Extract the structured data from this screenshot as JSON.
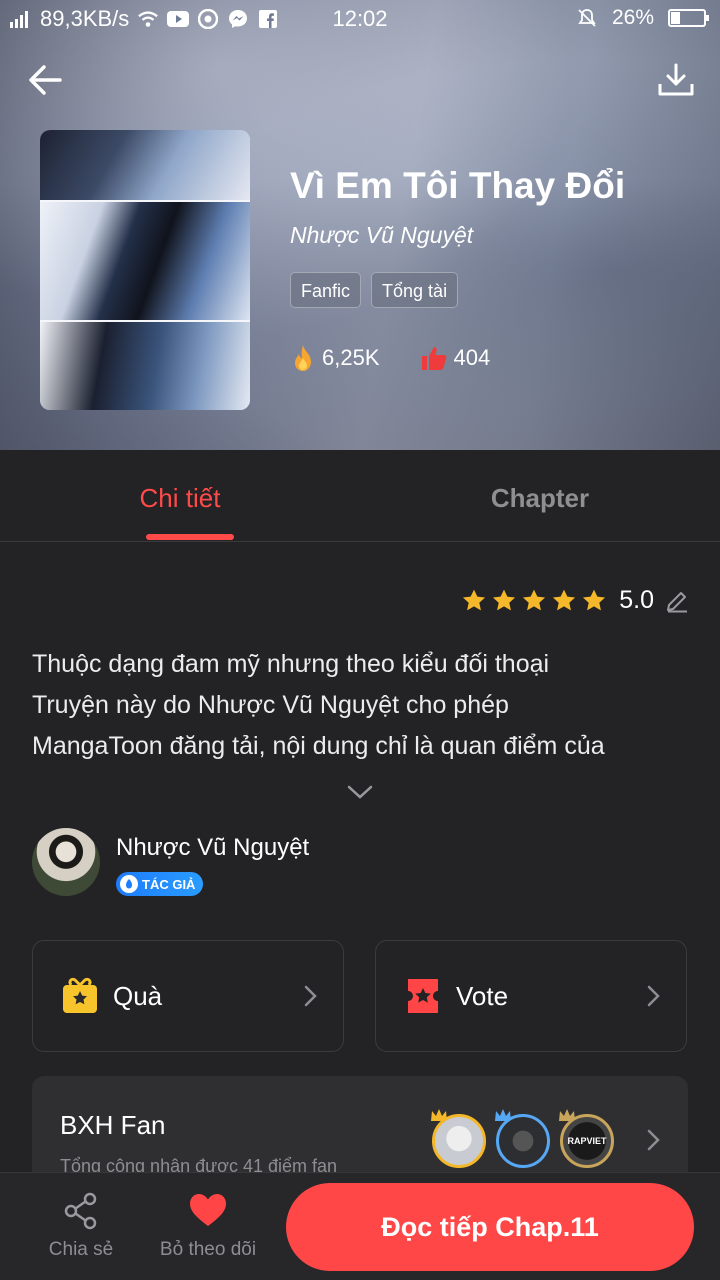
{
  "status_bar": {
    "network_speed": "89,3KB/s",
    "time": "12:02",
    "battery": "26%",
    "battery_level": 0.26
  },
  "story": {
    "title": "Vì Em Tôi Thay Đổi",
    "author": "Nhược Vũ Nguyệt",
    "tags": [
      "Fanfic",
      "Tổng tài"
    ],
    "views": "6,25K",
    "likes": "404"
  },
  "tabs": [
    {
      "label": "Chi tiết",
      "active": true
    },
    {
      "label": "Chapter",
      "active": false
    }
  ],
  "rating": {
    "value": "5.0",
    "stars": 5
  },
  "description": [
    "Thuộc dạng đam mỹ nhưng theo kiểu đối thoại",
    "Truyện này do Nhược Vũ Nguyệt cho phép",
    "MangaToon đăng tải, nội dung chỉ là quan điểm của"
  ],
  "author_profile": {
    "name": "Nhược Vũ Nguyệt",
    "badge": "TÁC GIẢ"
  },
  "actions": {
    "gift_label": "Quà",
    "vote_label": "Vote"
  },
  "fan_ranking": {
    "title": "BXH Fan",
    "subtitle": "Tổng công nhận được 41 điểm fan",
    "top_fan_text": "RAPVIET"
  },
  "bottom_bar": {
    "share_label": "Chia sẻ",
    "unfollow_label": "Bỏ theo dõi",
    "read_label": "Đọc tiếp Chap.11"
  },
  "colors": {
    "accent": "#ff4a4a",
    "background": "#232325",
    "badge_blue": "#1e7cff",
    "star": "#f6b82b"
  }
}
